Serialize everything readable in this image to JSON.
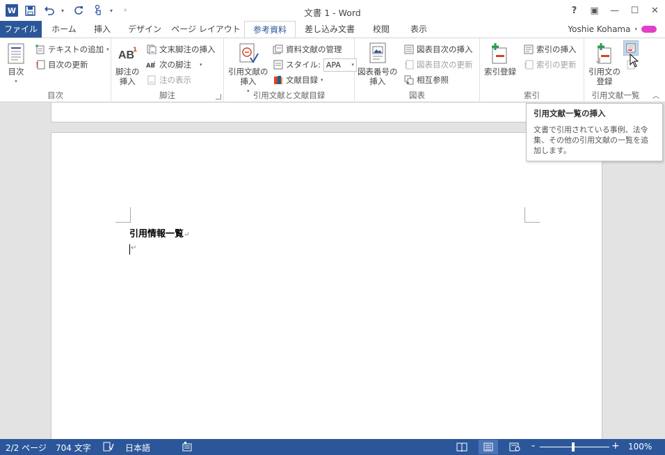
{
  "window": {
    "title": "文書 1 - Word",
    "help": "?",
    "ribbon_options": "▣",
    "minimize": "—",
    "maximize": "☐",
    "close": "✕"
  },
  "qat": {
    "logo": "W",
    "save_icon": "save-icon",
    "undo_icon": "undo-icon",
    "redo_icon": "redo-icon",
    "touch_icon": "touch-icon"
  },
  "tabs": [
    {
      "label": "ファイル"
    },
    {
      "label": "ホーム"
    },
    {
      "label": "挿入"
    },
    {
      "label": "デザイン"
    },
    {
      "label": "ページ レイアウト"
    },
    {
      "label": "参考資料"
    },
    {
      "label": "差し込み文書"
    },
    {
      "label": "校閲"
    },
    {
      "label": "表示"
    }
  ],
  "user": {
    "name": "Yoshie Kohama"
  },
  "ribbon": {
    "toc": {
      "label": "目次",
      "big": "目次",
      "add_text": "テキストの追加",
      "update": "目次の更新"
    },
    "footnotes": {
      "label": "脚注",
      "big_line1": "脚注の",
      "big_line2": "挿入",
      "endnote": "文末脚注の挿入",
      "next": "次の脚注",
      "show": "注の表示"
    },
    "citations": {
      "label": "引用文献と文献目録",
      "big_line1": "引用文献の",
      "big_line2": "挿入",
      "manage": "資料文献の管理",
      "style_label": "スタイル:",
      "style_value": "APA",
      "bibliography": "文献目録"
    },
    "captions": {
      "label": "図表",
      "big_line1": "図表番号の",
      "big_line2": "挿入",
      "insert_tof": "図表目次の挿入",
      "update_tof": "図表目次の更新",
      "cross_ref": "相互参照"
    },
    "index": {
      "label": "索引",
      "big": "索引登録",
      "insert_index": "索引の挿入",
      "update_index": "索引の更新"
    },
    "toa": {
      "label": "引用文献一覧",
      "big_line1": "引用文の",
      "big_line2": "登録"
    }
  },
  "tooltip": {
    "title": "引用文献一覧の挿入",
    "body": "文書で引用されている事例、法令集、その他の引用文献の一覧を追加します。"
  },
  "document": {
    "heading": "引用情報一覧",
    "para_mark": "↵"
  },
  "status": {
    "page": "2/2 ページ",
    "words": "704 文字",
    "language": "日本語",
    "zoom": "100%",
    "zoom_minus": "-",
    "zoom_plus": "+"
  },
  "colors": {
    "accent": "#2b579a",
    "tab_active": "#2b579a"
  }
}
